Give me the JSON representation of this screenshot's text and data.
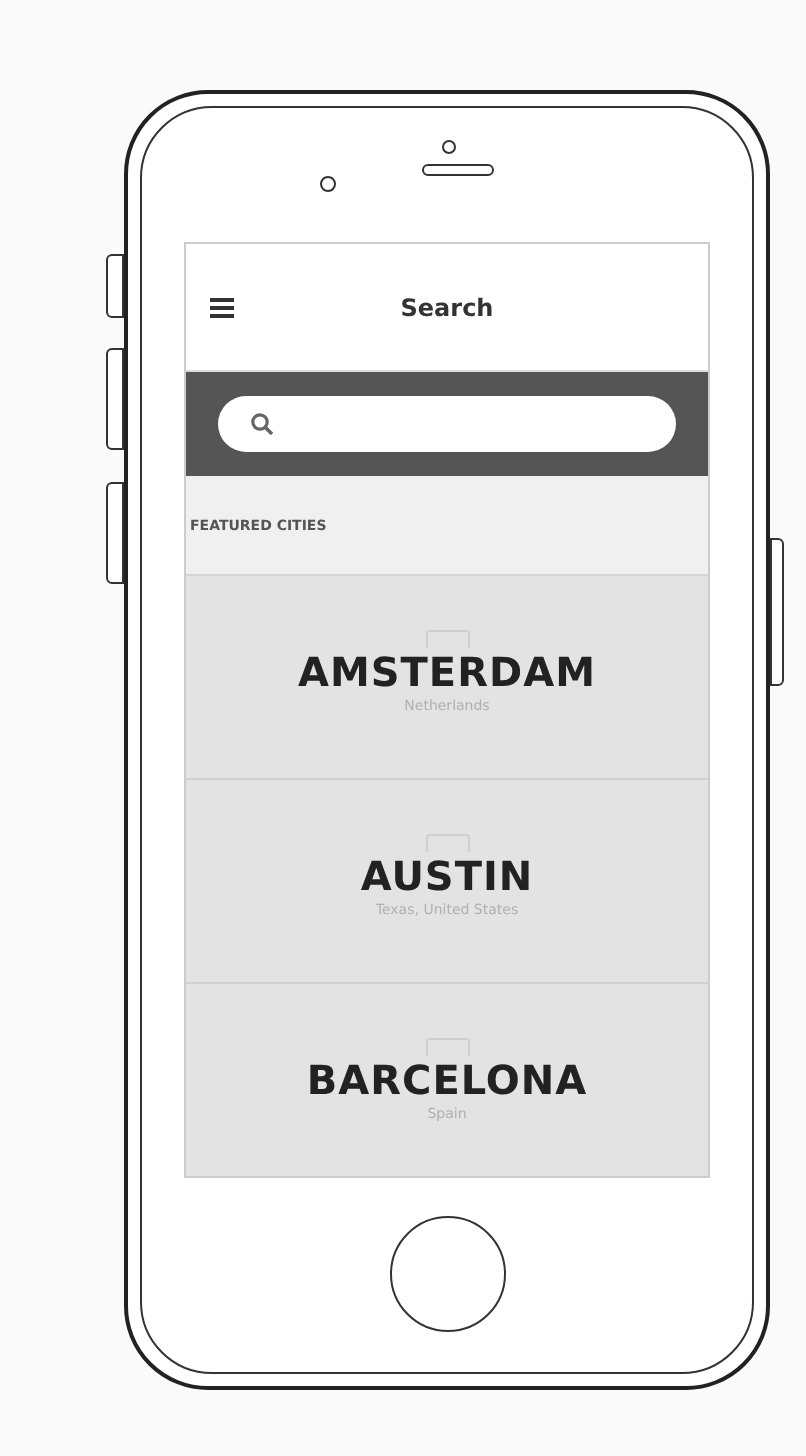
{
  "header": {
    "title": "Search"
  },
  "section_label": "FEATURED CITIES",
  "cities": [
    {
      "name": "AMSTERDAM",
      "location": "Netherlands"
    },
    {
      "name": "AUSTIN",
      "location": "Texas, United States"
    },
    {
      "name": "BARCELONA",
      "location": "Spain"
    }
  ]
}
